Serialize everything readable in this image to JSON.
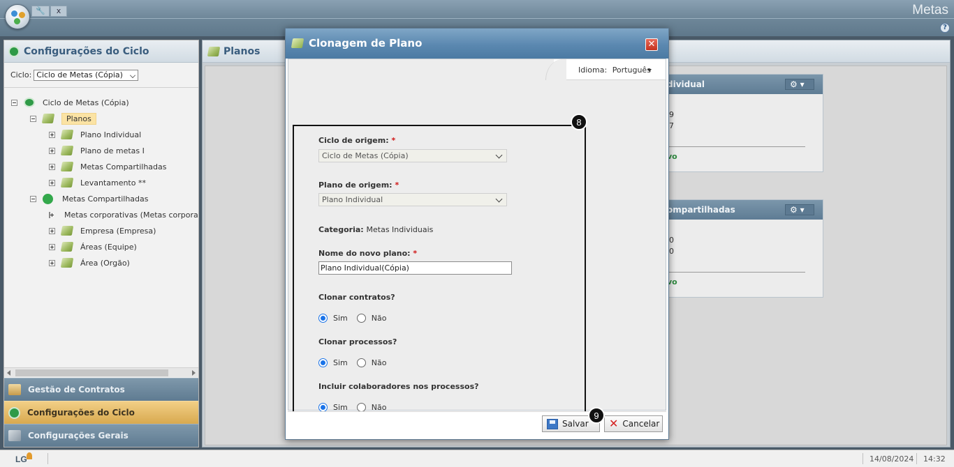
{
  "window": {
    "app_title": "Metas",
    "tab_close": "x"
  },
  "left_panel": {
    "title": "Configurações do Ciclo",
    "cycle_label": "Ciclo:",
    "cycle_value": "Ciclo de Metas (Cópia)",
    "tree": [
      {
        "label": "Ciclo de Metas (Cópia)",
        "level": 0,
        "icon": "cycle-icon",
        "toggle": "minus"
      },
      {
        "label": "Planos",
        "level": 1,
        "icon": "plan-icon",
        "toggle": "minus",
        "selected": true
      },
      {
        "label": "Plano Individual",
        "level": 2,
        "icon": "plan-icon",
        "toggle": "plus"
      },
      {
        "label": "Plano de metas I",
        "level": 2,
        "icon": "plan-icon",
        "toggle": "plus"
      },
      {
        "label": "Metas Compartilhadas",
        "level": 2,
        "icon": "plan-icon",
        "toggle": "plus"
      },
      {
        "label": "Levantamento **",
        "level": 2,
        "icon": "plan-icon",
        "toggle": "plus"
      },
      {
        "label": "Metas Compartilhadas",
        "level": 1,
        "icon": "share-icon",
        "toggle": "minus"
      },
      {
        "label": "Metas corporativas (Metas corporativas)",
        "level": 2,
        "icon": "plan-icon",
        "toggle": "plus"
      },
      {
        "label": "Empresa (Empresa)",
        "level": 2,
        "icon": "plan-icon",
        "toggle": "plus"
      },
      {
        "label": "Áreas (Equipe)",
        "level": 2,
        "icon": "plan-icon",
        "toggle": "plus"
      },
      {
        "label": "Área (Orgão)",
        "level": 2,
        "icon": "plan-icon",
        "toggle": "plus"
      }
    ],
    "accordion": [
      {
        "label": "Gestão de Contratos",
        "active": false
      },
      {
        "label": "Configurações do Ciclo",
        "active": true
      },
      {
        "label": "Configurações Gerais",
        "active": false
      }
    ]
  },
  "main": {
    "title": "Planos",
    "cards": [
      {
        "title": "dividual",
        "num1": "9",
        "num2": "7",
        "link": "vo",
        "gear": "⚙ ▾"
      },
      {
        "title": "ompartilhadas",
        "num1": "0",
        "num2": "0",
        "link": "vo",
        "gear": "⚙ ▾"
      }
    ]
  },
  "modal": {
    "title": "Clonagem de Plano",
    "close": "✕",
    "language_label": "Idioma:",
    "language_value": "Português",
    "badge_form": "8",
    "badge_save": "9",
    "fields": {
      "origin_cycle_label": "Ciclo de origem:",
      "origin_cycle_value": "Ciclo de Metas (Cópia)",
      "origin_plan_label": "Plano de origem:",
      "origin_plan_value": "Plano Individual",
      "category_label": "Categoria:",
      "category_value": "Metas Individuais",
      "new_name_label": "Nome do novo plano:",
      "new_name_value": "Plano Individual(Cópia)",
      "required_mark": "*",
      "clone_contracts_label": "Clonar contratos?",
      "clone_processes_label": "Clonar processos?",
      "include_collaborators_label": "Incluir colaboradores nos processos?",
      "yes": "Sim",
      "no": "Não"
    },
    "selections": {
      "clone_contracts": "Sim",
      "clone_processes": "Sim",
      "include_collaborators": "Sim"
    },
    "save_label": "Salvar",
    "cancel_label": "Cancelar"
  },
  "statusbar": {
    "logo": "LG",
    "date": "14/08/2024",
    "time": "14:32"
  }
}
